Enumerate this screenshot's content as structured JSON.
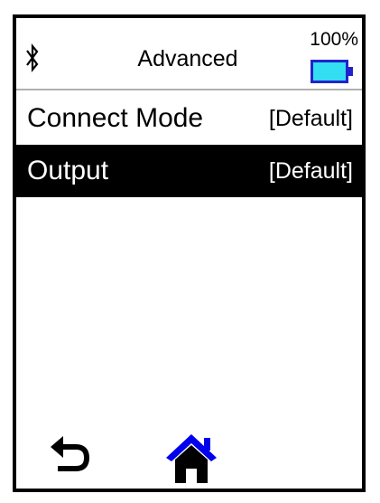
{
  "header": {
    "title": "Advanced",
    "bluetooth_icon": "bluetooth-icon",
    "battery": {
      "percent_text": "100%",
      "level": 1.0,
      "fill_color": "#33ddf2",
      "border_color": "#2222cc"
    }
  },
  "menu": {
    "items": [
      {
        "label": "Connect Mode",
        "value": "[Default]",
        "selected": false
      },
      {
        "label": "Output",
        "value": "[Default]",
        "selected": true
      }
    ]
  },
  "footer": {
    "back_icon": "back-arrow-icon",
    "home_icon": "home-icon",
    "home_color": "#0000ee"
  }
}
